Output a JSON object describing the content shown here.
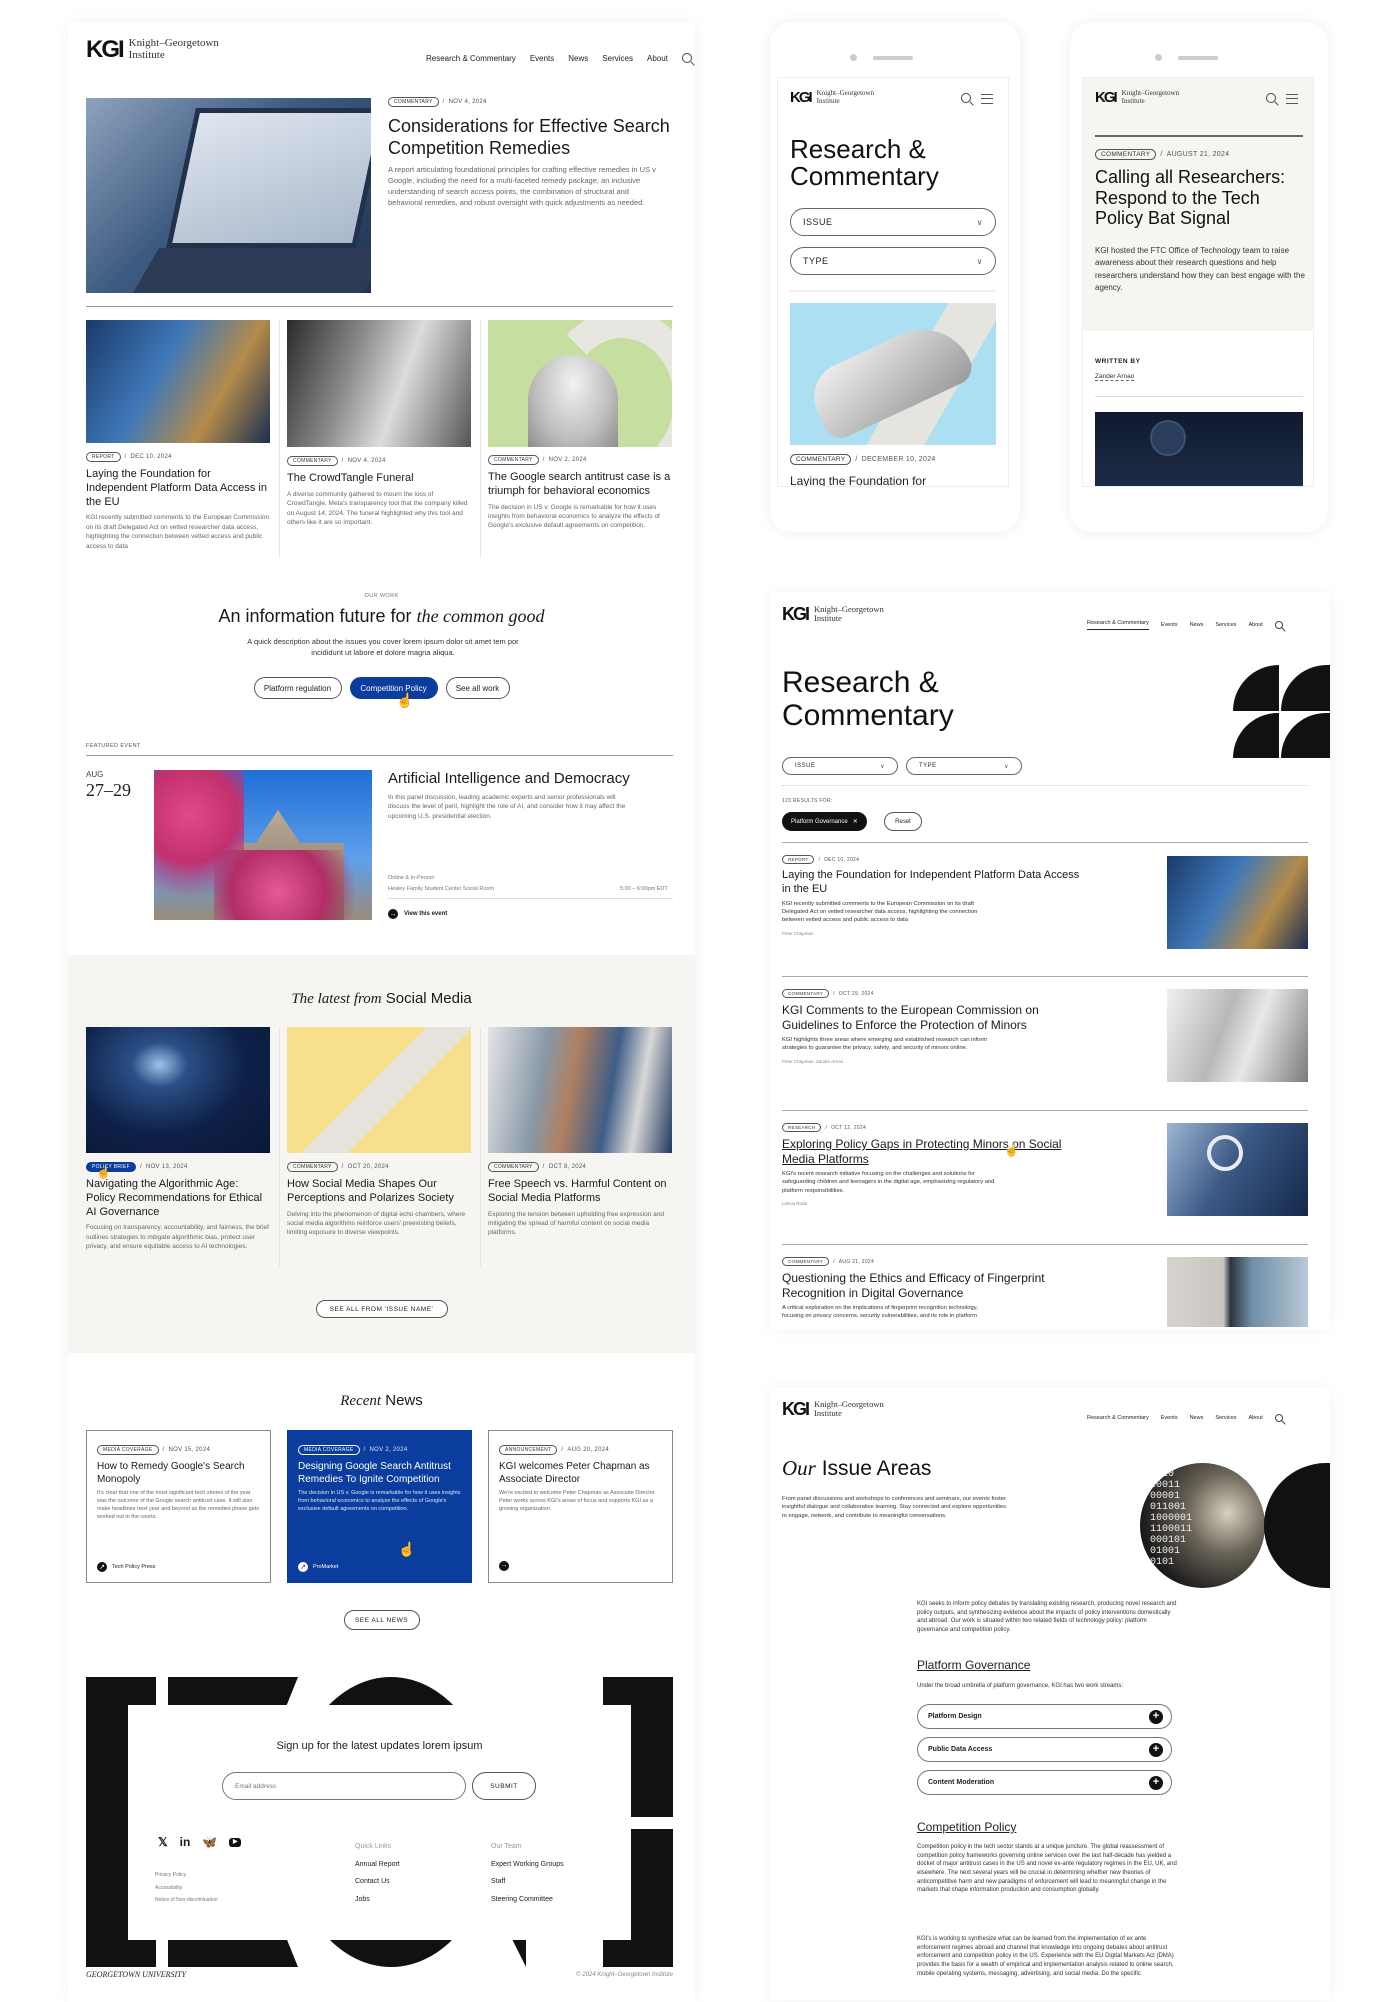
{
  "brand": {
    "mark": "KGI",
    "name_line1": "Knight–Georgetown",
    "name_line2": "Institute"
  },
  "nav": {
    "items": [
      "Research & Commentary",
      "Events",
      "News",
      "Services",
      "About"
    ]
  },
  "home": {
    "hero": {
      "tag": "COMMENTARY",
      "date": "NOV 4, 2024",
      "title": "Considerations for Effective Search Competition Remedies",
      "desc": "A report articulating foundational principles for crafting effective remedies in US v Google, including the need for a multi-faceted remedy package, an inclusive understanding of search access points, the combination of structural and behavioral remedies, and robust oversight with quick adjustments as needed."
    },
    "articles": [
      {
        "tag": "REPORT",
        "date": "DEC 10, 2024",
        "title": "Laying the Foundation for Independent Platform Data Access in the EU",
        "desc": "KGI recently submitted comments to the European Commission on its draft Delegated Act on vetted researcher data access, highlighting the connection between vetted access and public access to data"
      },
      {
        "tag": "COMMENTARY",
        "date": "NOV 4, 2024",
        "title": "The CrowdTangle Funeral",
        "desc": "A diverse community gathered to mourn the loss of CrowdTangle, Meta's transparency tool that the company killed on August 14, 2024. The funeral highlighted why this tool and others like it are so important."
      },
      {
        "tag": "COMMENTARY",
        "date": "NOV 2, 2024",
        "title": "The Google search antitrust case is a triumph for behavioral economics",
        "desc": "The decision in US v. Google is remarkable for how it uses insights from behavioral economics to analyze the effects of Google's exclusive default agreements on competition."
      }
    ],
    "our_work": {
      "eyebrow": "OUR WORK",
      "title_plain": "An information future for ",
      "title_italic": "the common good",
      "desc": "A quick description about the issues you cover lorem ipsum dolor sit amet tem por incididunt ut labore et dolore magna aliqua.",
      "buttons": [
        "Platform regulation",
        "Competition Policy",
        "See all work"
      ]
    },
    "event": {
      "eyebrow": "FEATURED EVENT",
      "month": "AUG",
      "days": "27–29",
      "title": "Artificial Intelligence and Democracy",
      "desc": "In this panel discussion, leading academic experts and senior professionals will discuss the level of peril, highlight the role of AI, and consider how it may affect the upcoming U.S. presidential election.",
      "format": "Online & In-Person",
      "location": "Healey Family Student Center Social Room",
      "time": "5:00 – 6:00pm EDT",
      "cta": "View this event"
    },
    "social": {
      "title_italic": "The latest from",
      "title_plain": "Social Media",
      "cards": [
        {
          "tag": "POLICY BRIEF",
          "date": "NOV 13, 2024",
          "title": "Navigating the Algorithmic Age: Policy Recommendations for Ethical AI Governance",
          "desc": "Focusing on transparency, accountability, and fairness, the brief outlines strategies to mitigate algorithmic bias, protect user privacy, and ensure equitable access to AI technologies."
        },
        {
          "tag": "COMMENTARY",
          "date": "OCT 20, 2024",
          "title": "How Social Media Shapes Our Perceptions and Polarizes Society",
          "desc": "Delving into the phenomenon of digital echo chambers, where social media algorithms reinforce users' preexisting beliefs, limiting exposure to diverse viewpoints."
        },
        {
          "tag": "COMMENTARY",
          "date": "OCT 8, 2024",
          "title": "Free Speech vs. Harmful Content on Social Media Platforms",
          "desc": "Exploring the tension between upholding free expression and mitigating the spread of harmful content on social media platforms."
        }
      ],
      "cta": "SEE ALL FROM 'ISSUE NAME'"
    },
    "news": {
      "title_italic": "Recent",
      "title_plain": "News",
      "cards": [
        {
          "tag": "MEDIA COVERAGE",
          "date": "NOV 15, 2024",
          "title": "How to Remedy Google's Search Monopoly",
          "desc": "It's clear that one of the most significant tech stories of the year was the outcome of the Google search antitrust case. It will also make headlines next year and beyond as the remedies phase gets worked out in the courts.",
          "source": "Tech Policy Press"
        },
        {
          "tag": "MEDIA COVERAGE",
          "date": "NOV 2, 2024",
          "title": "Designing Google Search Antitrust Remedies To Ignite Competition",
          "desc": "The decision in US v. Google is remarkable for how it uses insights from behavioral economics to analyze the effects of Google's exclusive default agreements on competition.",
          "source": "ProMarket"
        },
        {
          "tag": "ANNOUNCEMENT",
          "date": "AUG 20, 2024",
          "title": "KGI welcomes Peter Chapman as Associate Director",
          "desc": "We're excited to welcome Peter Chapman as Associate Director. Peter works across KGI's areas of focus and supports KGI as a growing organization.",
          "source": ""
        }
      ],
      "cta": "SEE ALL NEWS"
    },
    "footer": {
      "signup": "Sign up for the latest updates lorem ipsum",
      "email_placeholder": "Email address",
      "submit": "SUBMIT",
      "legal": [
        "Privacy Policy",
        "Accessibility",
        "Notice of Non-discrimination"
      ],
      "quick_title": "Quick Links",
      "quick": [
        "Annual Report",
        "Contact Us",
        "Jobs"
      ],
      "team_title": "Our Team",
      "team": [
        "Expert Working Groups",
        "Staff",
        "Steering Committee"
      ],
      "university": "GEORGETOWN UNIVERSITY",
      "copyright": "© 2024 Knight–Georgetown Institute"
    }
  },
  "mobile1": {
    "title": "Research & Commentary",
    "filters": [
      "ISSUE",
      "TYPE"
    ],
    "tag": "COMMENTARY",
    "date": "DECEMBER 10, 2024",
    "title_peek": "Laying the Foundation for"
  },
  "mobile2": {
    "tag": "COMMENTARY",
    "date": "AUGUST 21, 2024",
    "title": "Calling all Researchers: Respond to the Tech Policy Bat Signal",
    "desc": "KGI hosted the FTC Office of Technology team to raise awareness about their research questions and help researchers understand how they can best engage with the agency.",
    "written_by": "WRITTEN BY",
    "author": "Zander Arnao"
  },
  "research": {
    "title": "Research & Commentary",
    "filters": [
      "ISSUE",
      "TYPE"
    ],
    "results": "123 RESULTS FOR:",
    "chip": "Platform Governance",
    "reset": "Reset",
    "items": [
      {
        "tag": "REPORT",
        "date": "DEC 10, 2024",
        "title": "Laying the Foundation for Independent Platform Data Access in the EU",
        "desc": "KGI recently submitted comments to the European Commission on its draft Delegated Act on vetted researcher data access, highlighting the connection between vetted access and public access to data",
        "author": "Peter Chapman"
      },
      {
        "tag": "COMMENTARY",
        "date": "OCT 29, 2024",
        "title": "KGI Comments to the European Commission on Guidelines to Enforce the Protection of Minors",
        "desc": "KGI highlights three areas where emerging and established research can inform strategies to guarantee the privacy, safety, and security of minors online.",
        "author": "Peter Chapman, Zander Arnao"
      },
      {
        "tag": "RESEARCH",
        "date": "OCT 12, 2024",
        "title": "Exploring Policy Gaps in Protecting Minors on Social Media Platforms",
        "desc": "KGI's recent research initiative focusing on the challenges and solutions for safeguarding children and teenagers in the digital age, emphasizing regulatory and platform responsibilities.",
        "author": "Leticia Roda"
      },
      {
        "tag": "COMMENTARY",
        "date": "AUG 21, 2024",
        "title": "Questioning the Ethics and Efficacy of Fingerprint Recognition in Digital Governance",
        "desc": "A critical exploration on the implications of fingerprint recognition technology, focusing on privacy concerns, security vulnerabilities, and its role in platform",
        "author": ""
      }
    ]
  },
  "issues": {
    "title_italic": "Our",
    "title_plain": "Issue Areas",
    "intro": "From panel discussions and workshops to conferences and seminars, our events foster insightful dialogue and collaborative learning. Stay connected and explore opportunities to engage, network, and contribute to meaningful conversations.",
    "body": "KGI seeks to inform policy debates by translating existing research, producing novel research and policy outputs, and synthesizing evidence about the impacts of policy interventions domestically and abroad. Our work is situated within two related fields of technology policy: platform governance and competition policy.",
    "pg_title": "Platform Governance",
    "pg_desc": "Under the broad umbrella of platform governance, KGI has two work streams:",
    "accordions": [
      "Platform Design",
      "Public Data Access",
      "Content Moderation"
    ],
    "cp_title": "Competition Policy",
    "cp_p1": "Competition policy in the tech sector stands at a unique juncture. The global reassessment of competition policy frameworks governing online services over the last half-decade has yielded a docket of major antitrust cases in the US and novel ex-ante regulatory regimes in the EU, UK, and elsewhere. The next several years will be crucial in determining whether new theories of anticompetitive harm and new paradigms of enforcement will lead to meaningful change in the markets that shape information production and consumption globally.",
    "cp_p2": "KGI's is working to synthesize what can be learned from the implementation of ex ante enforcement regimes abroad and channel that knowledge into ongoing debates about antitrust enforcement and competition policy in the US. Experience with the EU Digital Markets Act (DMA) provides the basis for a wealth of empirical and implementation analysis related to online search, mobile operating systems, messaging, advertising, and social media. Do the specific"
  },
  "colors": {
    "accent": "#0a3d9e",
    "ink": "#1a1a1a",
    "cream": "#f7f5f1"
  }
}
